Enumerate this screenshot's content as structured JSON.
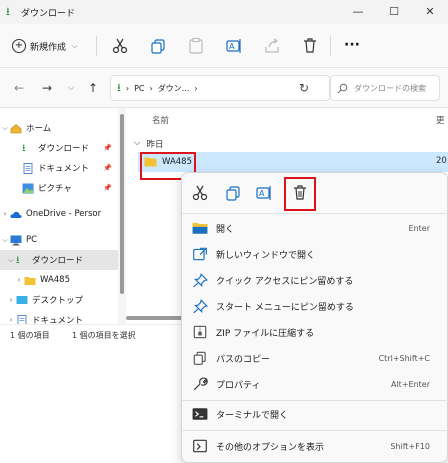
{
  "window": {
    "title": "ダウンロード",
    "controls": [
      "minimize",
      "maximize",
      "close"
    ]
  },
  "toolbar": {
    "new_label": "新規作成",
    "icons": [
      "cut-icon",
      "copy-icon",
      "paste-icon",
      "rename-icon",
      "share-icon",
      "delete-icon",
      "more-icon"
    ]
  },
  "address": {
    "crumbs": [
      "PC",
      "ダウン..."
    ],
    "search_placeholder": "ダウンロードの検索"
  },
  "nav": {
    "items": [
      {
        "label": "ホーム",
        "pinned": false
      },
      {
        "label": "ダウンロード",
        "pinned": true
      },
      {
        "label": "ドキュメント",
        "pinned": true
      },
      {
        "label": "ピクチャ",
        "pinned": true
      },
      {
        "label": "OneDrive - Persor",
        "pinned": false
      },
      {
        "label": "PC",
        "pinned": false
      },
      {
        "label": "ダウンロード",
        "pinned": false
      },
      {
        "label": "WA485",
        "pinned": false
      },
      {
        "label": "デスクトップ",
        "pinned": false
      },
      {
        "label": "ドキュメント",
        "pinned": false
      }
    ]
  },
  "content": {
    "columns": {
      "name": "名前",
      "date": "更"
    },
    "group": "昨日",
    "file": {
      "name": "WA485",
      "date": "20"
    }
  },
  "status": {
    "count": "1 個の項目",
    "selected": "1 個の項目を選択"
  },
  "context_menu": {
    "tools": [
      "cut-icon",
      "copy-icon",
      "rename-icon",
      "delete-icon"
    ],
    "items": [
      {
        "label": "開く",
        "shortcut": "Enter"
      },
      {
        "label": "新しいウィンドウで開く",
        "shortcut": ""
      },
      {
        "label": "クイック アクセスにピン留めする",
        "shortcut": ""
      },
      {
        "label": "スタート メニューにピン留めする",
        "shortcut": ""
      },
      {
        "label": "ZIP ファイルに圧縮する",
        "shortcut": ""
      },
      {
        "label": "パスのコピー",
        "shortcut": "Ctrl+Shift+C"
      },
      {
        "label": "プロパティ",
        "shortcut": "Alt+Enter"
      },
      {
        "label": "ターミナルで開く",
        "shortcut": ""
      },
      {
        "label": "その他のオプションを表示",
        "shortcut": "Shift+F10"
      }
    ]
  },
  "colors": {
    "highlight": "#d9141b",
    "selection": "#cce8ff",
    "accent_green": "#2a8a3a",
    "folder": "#f3c233"
  }
}
